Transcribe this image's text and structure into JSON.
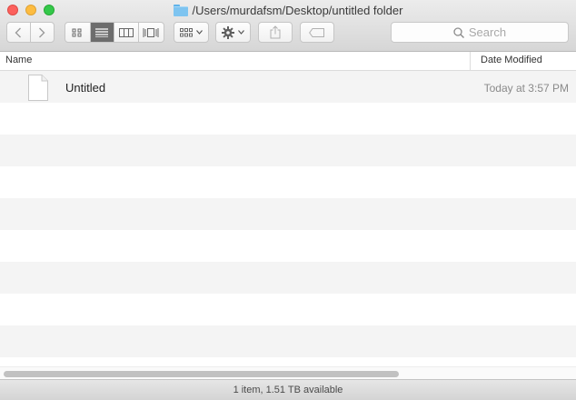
{
  "window": {
    "title": "/Users/murdafsm/Desktop/untitled folder"
  },
  "toolbar": {
    "back_icon": "chevron-left-icon",
    "forward_icon": "chevron-right-icon",
    "view_modes": [
      "icon-view",
      "list-view",
      "column-view",
      "cover-flow-view"
    ],
    "active_view": "list-view",
    "arrange_icon": "arrange-grid-icon",
    "action_icon": "gear-icon",
    "share_icon": "share-icon",
    "tags_icon": "tag-icon",
    "search_placeholder": "Search"
  },
  "columns": {
    "name": "Name",
    "date_modified": "Date Modified"
  },
  "files": [
    {
      "name": "Untitled",
      "date_modified": "Today at 3:57 PM",
      "icon": "document-icon"
    }
  ],
  "status": {
    "text": "1 item, 1.51 TB available"
  },
  "colors": {
    "close": "#fc605c",
    "minimize": "#fdbc40",
    "maximize": "#34c84a",
    "active_segment": "#6d6d6d"
  }
}
